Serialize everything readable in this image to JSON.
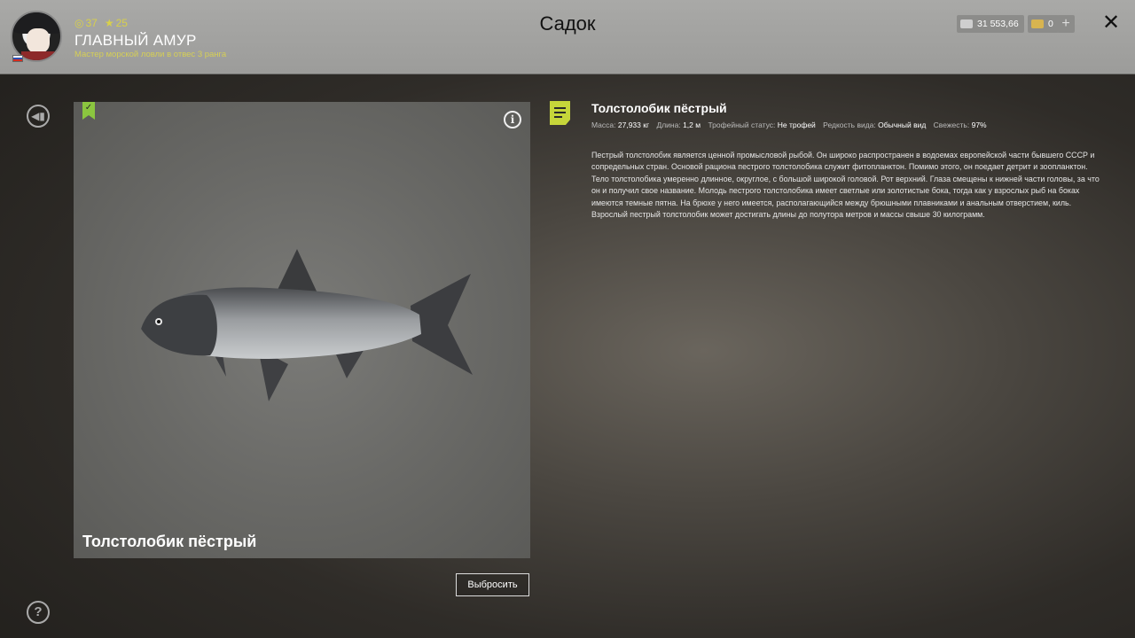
{
  "header": {
    "stats": {
      "coins_icon": "coin-icon",
      "coins": "37",
      "stars_icon": "star-icon",
      "stars": "25"
    },
    "player_name": "ГЛАВНЫЙ АМУР",
    "player_rank": "Мастер морской ловли в отвес 3 ранга",
    "page_title": "Садок",
    "money": "31 553,66",
    "gold": "0",
    "plus_label": "+",
    "close_label": "✕"
  },
  "fish": {
    "name_overlay": "Толстолобик пёстрый",
    "title": "Толстолобик пёстрый",
    "properties": [
      {
        "label": "Масса:",
        "value": "27,933 кг"
      },
      {
        "label": "Длина:",
        "value": "1,2 м"
      },
      {
        "label": "Трофейный статус:",
        "value": "Не трофей"
      },
      {
        "label": "Редкость вида:",
        "value": "Обычный вид"
      },
      {
        "label": "Свежесть:",
        "value": "97%"
      }
    ],
    "description": [
      "Пестрый толстолобик является ценной промысловой рыбой. Он широко распространен в водоемах европейской части бывшего СССР и сопредельных стран. Основой рациона пестрого толстолобика служит фитопланктон. Помимо этого, он поедает детрит и зоопланктон.",
      "Тело толстолобика умеренно длинное, округлое, с большой широкой головой. Рот верхний. Глаза смещены к нижней части головы, за что он и получил свое название. Молодь пестрого толстолобика имеет светлые или золотистые бока, тогда как у взрослых рыб на боках имеются темные пятна. На брюхе у него имеется, располагающийся между брюшными плавниками и анальным отверстием, киль.",
      "Взрослый пестрый толстолобик может достигать длины до полутора метров и массы свыше 30 килограмм."
    ]
  },
  "actions": {
    "throw_label": "Выбросить"
  },
  "icons": {
    "back": "back-arrow-icon",
    "help": "help-icon",
    "info": "info-icon",
    "bookmark": "bookmark-check-icon",
    "doc": "document-icon",
    "close": "close-icon"
  },
  "colors": {
    "accent": "#c6d63a",
    "bookmark": "#8bc63f",
    "rank_text": "#d6cf55"
  }
}
